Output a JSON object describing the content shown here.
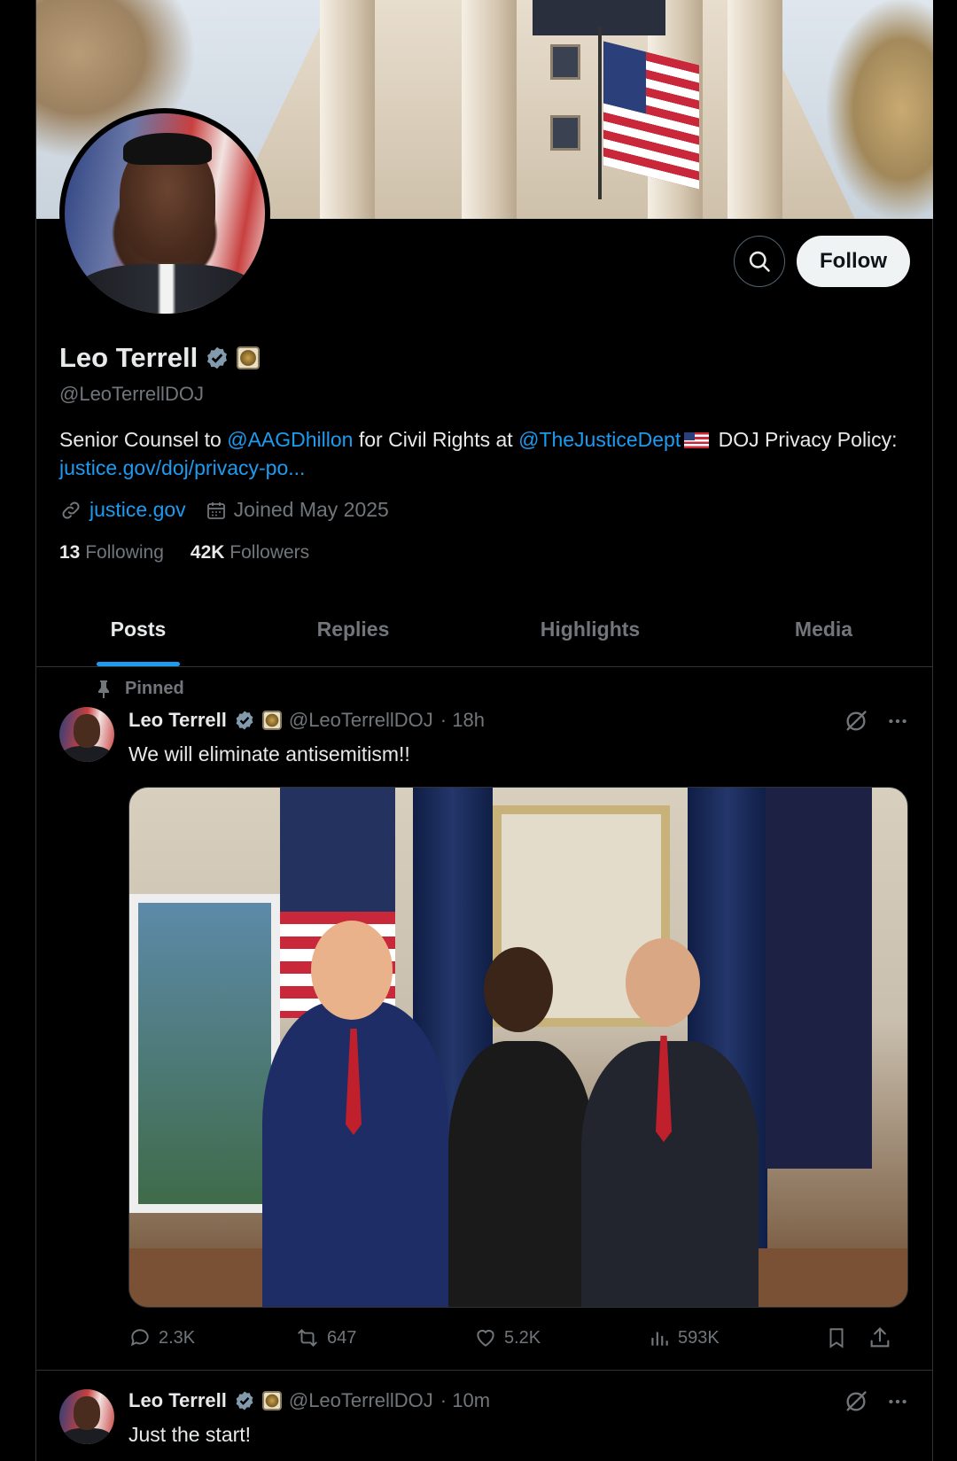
{
  "profile": {
    "name": "Leo Terrell",
    "handle": "@LeoTerrellDOJ",
    "bio": {
      "part1": "Senior Counsel to ",
      "mention1": "@AAGDhillon",
      "part2": " for Civil Rights at ",
      "mention2": "@TheJusticeDept",
      "part3": " DOJ Privacy Policy: ",
      "link": "justice.gov/doj/privacy-po..."
    },
    "website": "justice.gov",
    "joined": "Joined May 2025",
    "following_count": "13",
    "following_label": "Following",
    "followers_count": "42K",
    "followers_label": "Followers"
  },
  "actions": {
    "follow_label": "Follow"
  },
  "tabs": [
    {
      "label": "Posts"
    },
    {
      "label": "Replies"
    },
    {
      "label": "Highlights"
    },
    {
      "label": "Media"
    }
  ],
  "tweets": [
    {
      "pinned_label": "Pinned",
      "name": "Leo Terrell",
      "handle": "@LeoTerrellDOJ",
      "time": "· 18h",
      "text": "We will eliminate antisemitism!!",
      "replies": "2.3K",
      "reposts": "647",
      "likes": "5.2K",
      "views": "593K"
    },
    {
      "name": "Leo Terrell",
      "handle": "@LeoTerrellDOJ",
      "time": "· 10m",
      "text": "Just the start!"
    }
  ],
  "colors": {
    "accent": "#1d9bf0",
    "muted": "#71767b",
    "text": "#e7e9ea",
    "background": "#000000",
    "follow_bg": "#eff3f4"
  },
  "icons": [
    "search-icon",
    "verified-badge-icon",
    "doj-seal-icon",
    "link-icon",
    "calendar-icon",
    "pin-icon",
    "grok-icon",
    "more-icon",
    "reply-icon",
    "repost-icon",
    "like-icon",
    "views-icon",
    "bookmark-icon",
    "share-icon"
  ]
}
